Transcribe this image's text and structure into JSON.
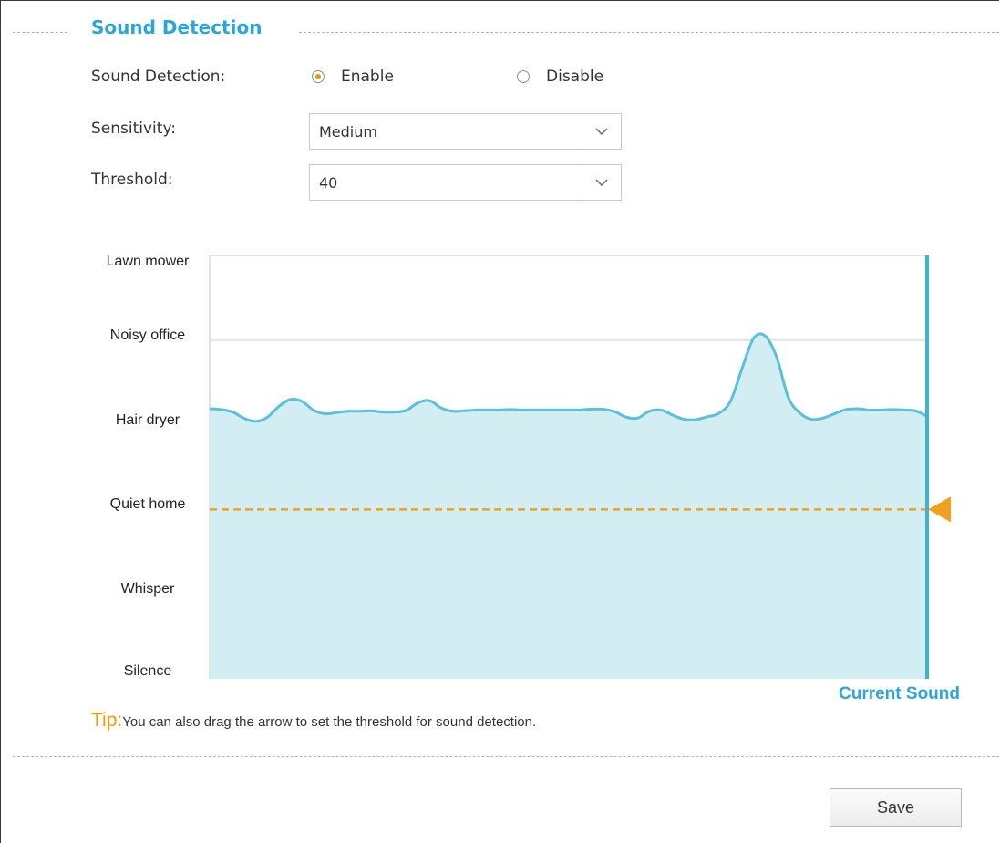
{
  "section": {
    "title": "Sound Detection"
  },
  "form": {
    "detection_label": "Sound Detection:",
    "enable_label": "Enable",
    "disable_label": "Disable",
    "enabled": true,
    "sensitivity_label": "Sensitivity:",
    "sensitivity_value": "Medium",
    "threshold_label": "Threshold:",
    "threshold_value": "40"
  },
  "chart": {
    "levels": [
      "Lawn mower",
      "Noisy office",
      "Hair dryer",
      "Quiet home",
      "Whisper",
      "Silence"
    ],
    "current_sound_label": "Current Sound",
    "threshold": 40,
    "colors": {
      "line": "#5bc0d9",
      "fill": "#d2eef3",
      "threshold": "#f0a020",
      "cursor": "#3bb3d1",
      "grid": "#e3e3e3"
    }
  },
  "chart_data": {
    "type": "area",
    "ylabel": "",
    "xlabel": "",
    "y_categories": [
      "Silence",
      "Whisper",
      "Quiet home",
      "Hair dryer",
      "Noisy office",
      "Lawn mower"
    ],
    "ylim": [
      0,
      100
    ],
    "threshold": 40,
    "values": [
      63.8,
      63.6,
      63.0,
      61.5,
      60.8,
      61.8,
      64.4,
      66.0,
      65.5,
      63.4,
      62.6,
      62.9,
      63.2,
      63.2,
      63.3,
      63.0,
      63.0,
      63.4,
      65.2,
      65.7,
      64.0,
      63.2,
      63.3,
      63.5,
      63.5,
      63.5,
      63.6,
      63.5,
      63.5,
      63.5,
      63.5,
      63.5,
      63.5,
      63.7,
      63.7,
      63.1,
      61.8,
      61.6,
      63.2,
      63.5,
      62.3,
      61.3,
      61.2,
      61.9,
      62.7,
      65.5,
      73.2,
      80.4,
      81.0,
      76.0,
      66.5,
      62.8,
      61.3,
      61.6,
      62.6,
      63.6,
      63.8,
      63.5,
      63.5,
      63.6,
      63.5,
      63.3,
      62.0
    ]
  },
  "tip": {
    "label": "Tip:",
    "text": "You can also drag the arrow to set the threshold for sound detection."
  },
  "actions": {
    "save_label": "Save"
  }
}
